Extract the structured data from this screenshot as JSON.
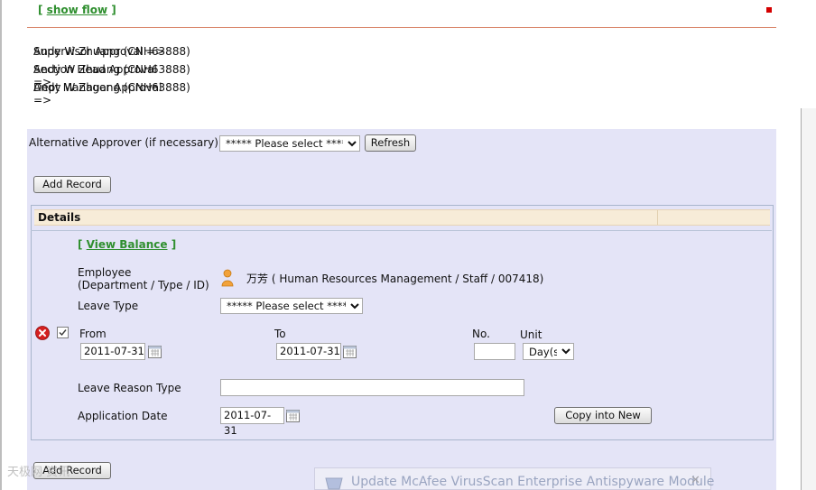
{
  "top": {
    "show_flow_open": "[",
    "show_flow_link": "show flow",
    "show_flow_close": "]"
  },
  "approvals": [
    {
      "label": "Supervisor Approval =>",
      "value": "Andy W Zhuang (CNH63888)"
    },
    {
      "label": "Section Head Approval =>",
      "value": "Andy W Zhuang (CNH63888)"
    },
    {
      "label": "Dept Manager Approval =>",
      "value": "Andy W Zhuang (CNH63888)"
    }
  ],
  "alternative": {
    "label": "Alternative Approver (if necessary)",
    "select_value": "***** Please select *****",
    "refresh_label": "Refresh"
  },
  "add_record_label": "Add Record",
  "details": {
    "header": "Details",
    "view_balance_open": "[",
    "view_balance_link": "View Balance",
    "view_balance_close": "]",
    "employee_label_1": "Employee",
    "employee_label_2": "(Department / Type / ID)",
    "employee_name": "万芳",
    "employee_info": "( Human Resources Management / Staff / 007418)",
    "leave_type_label": "Leave Type",
    "leave_type_value": "***** Please select *****",
    "from_label": "From",
    "from_value": "2011-07-31",
    "to_label": "To",
    "to_value": "2011-07-31",
    "no_label": "No.",
    "no_value": "",
    "unit_label": "Unit",
    "unit_value": "Day(s)",
    "reason_label": "Leave Reason Type",
    "reason_value": "",
    "app_date_label": "Application Date",
    "app_date_value": "2011-07-31",
    "copy_label": "Copy into New"
  },
  "popup": {
    "text": "Update McAfee VirusScan Enterprise Antispyware Module",
    "close": "✕"
  },
  "watermark": "天极网 资讯",
  "icons": {
    "delete": "delete-icon",
    "calendar": "calendar-icon",
    "person": "person-icon",
    "checkbox": "checkbox"
  },
  "colors": {
    "link_green": "#2f8f2f",
    "panel": "#e4e4f7",
    "header": "#f7ecd8",
    "separator": "#d9866a",
    "marker": "#d40000"
  }
}
